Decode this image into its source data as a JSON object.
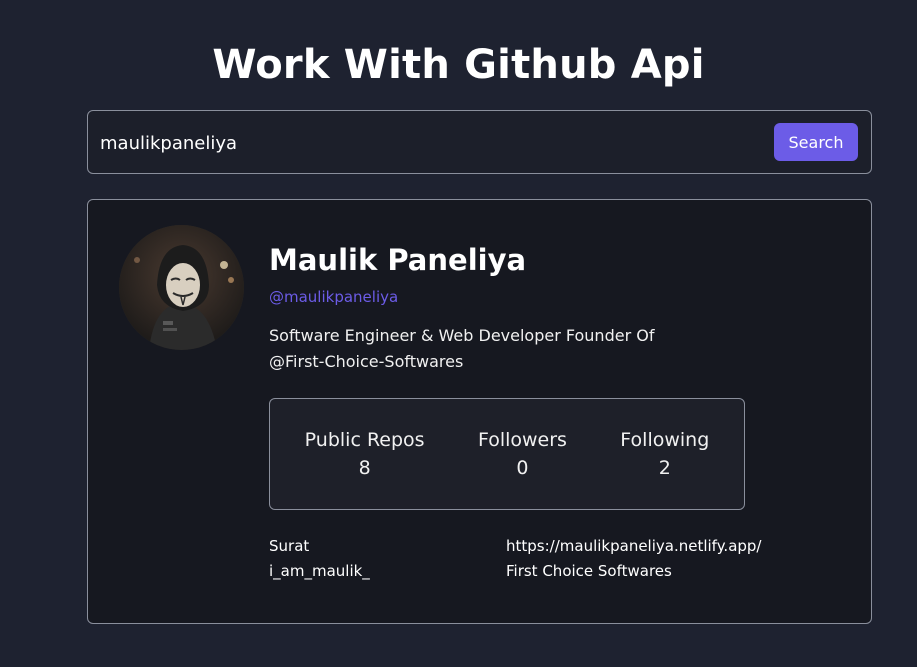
{
  "header": {
    "title": "Work With Github Api"
  },
  "search": {
    "value": "maulikpaneliya",
    "placeholder": "",
    "button_label": "Search"
  },
  "profile": {
    "name": "Maulik Paneliya",
    "login": "@maulikpaneliya",
    "bio": "Software Engineer & Web Developer Founder Of @First-Choice-Softwares",
    "stats": [
      {
        "label": "Public Repos",
        "value": "8"
      },
      {
        "label": "Followers",
        "value": "0"
      },
      {
        "label": "Following",
        "value": "2"
      }
    ],
    "location": "Surat",
    "blog": "https://maulikpaneliya.netlify.app/",
    "twitter": "i_am_maulik_",
    "company": "First Choice Softwares"
  },
  "colors": {
    "background": "#1e2230",
    "card": "#161820",
    "accent": "#6c5ce7",
    "border": "#8a8f9c"
  }
}
